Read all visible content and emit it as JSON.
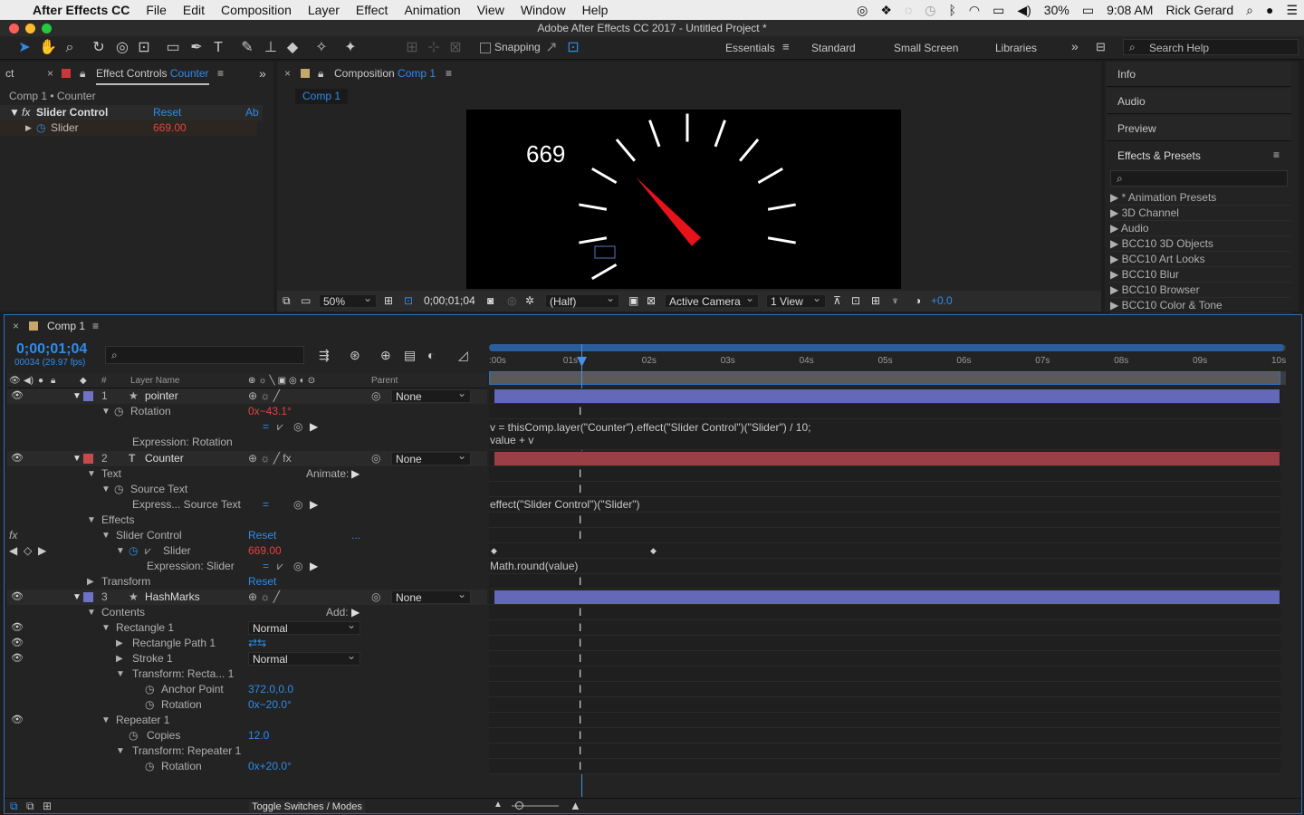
{
  "menubar": {
    "apple": "",
    "app": "After Effects CC",
    "items": [
      "File",
      "Edit",
      "Composition",
      "Layer",
      "Effect",
      "Animation",
      "View",
      "Window",
      "Help"
    ],
    "battery": "30%",
    "time": "9:08 AM",
    "user": "Rick Gerard"
  },
  "window_title": "Adobe After Effects CC 2017 - Untitled Project *",
  "toolbar": {
    "snapping": "Snapping",
    "workspaces": [
      "Essentials",
      "Standard",
      "Small Screen",
      "Libraries"
    ],
    "search_placeholder": "Search Help"
  },
  "effect_controls": {
    "tab_left": "ct",
    "tab_prefix": "Effect Controls ",
    "tab_layer": "Counter",
    "breadcrumb": "Comp 1 • Counter",
    "effect_name": "Slider Control",
    "reset": "Reset",
    "about": "Ab",
    "slider_label": "Slider",
    "slider_value": "669.00"
  },
  "composition": {
    "tab_prefix": "Composition ",
    "tab_name": "Comp 1",
    "subtab": "Comp 1",
    "counter_display": "669",
    "needle_rotation_deg": -43.1,
    "zoom": "50%",
    "timecode": "0;00;01;04",
    "resolution": "(Half)",
    "camera": "Active Camera",
    "views": "1 View",
    "exposure": "+0.0"
  },
  "right_panel": {
    "tabs": [
      "Info",
      "Audio",
      "Preview"
    ],
    "effects_title": "Effects & Presets",
    "effects_list": [
      "* Animation Presets",
      "3D Channel",
      "Audio",
      "BCC10 3D Objects",
      "BCC10 Art Looks",
      "BCC10 Blur",
      "BCC10 Browser",
      "BCC10 Color & Tone"
    ]
  },
  "timeline": {
    "tab": "Comp 1",
    "timecode": "0;00;01;04",
    "fps": "00034 (29.97 fps)",
    "col_layer": "Layer Name",
    "col_parent": "Parent",
    "col_hash": "#",
    "ticks": [
      ":00s",
      "01s",
      "02s",
      "03s",
      "04s",
      "05s",
      "06s",
      "07s",
      "08s",
      "09s",
      "10s"
    ],
    "playhead_seconds": 1.134,
    "expr_pointer_1": "v = thisComp.layer(\"Counter\").effect(\"Slider Control\")(\"Slider\") / 10;",
    "expr_pointer_2": "value + v",
    "expr_source": "effect(\"Slider Control\")(\"Slider\")",
    "expr_slider": "Math.round(value)",
    "footer": "Toggle Switches / Modes",
    "layers": {
      "l1": {
        "num": "1",
        "name": "pointer",
        "parent": "None",
        "color": "#6f72c6"
      },
      "l2": {
        "num": "2",
        "name": "Counter",
        "parent": "None",
        "color": "#c84a4a"
      },
      "l3": {
        "num": "3",
        "name": "HashMarks",
        "parent": "None",
        "color": "#6f72c6"
      }
    },
    "props": {
      "rotation": "Rotation",
      "rotation_val": "0x−43.1°",
      "expression_rotation": "Expression: Rotation",
      "text": "Text",
      "animate": "Animate:",
      "source_text": "Source Text",
      "express_source": "Express... Source Text",
      "effects": "Effects",
      "slider_control": "Slider Control",
      "reset": "Reset",
      "dots": "...",
      "slider": "Slider",
      "slider_val": "669.00",
      "expression_slider": "Expression: Slider",
      "transform": "Transform",
      "contents": "Contents",
      "add": "Add:",
      "rectangle1": "Rectangle 1",
      "normal": "Normal",
      "rectangle_path": "Rectangle Path 1",
      "stroke1": "Stroke 1",
      "transform_rect": "Transform: Recta... 1",
      "anchor_point": "Anchor Point",
      "anchor_val": "372.0,0.0",
      "rect_rotation": "Rotation",
      "rect_rotation_val": "0x−20.0°",
      "repeater": "Repeater 1",
      "copies": "Copies",
      "copies_val": "12.0",
      "transform_rep": "Transform: Repeater 1",
      "rep_rotation": "Rotation",
      "rep_rotation_val": "0x+20.0°"
    }
  }
}
